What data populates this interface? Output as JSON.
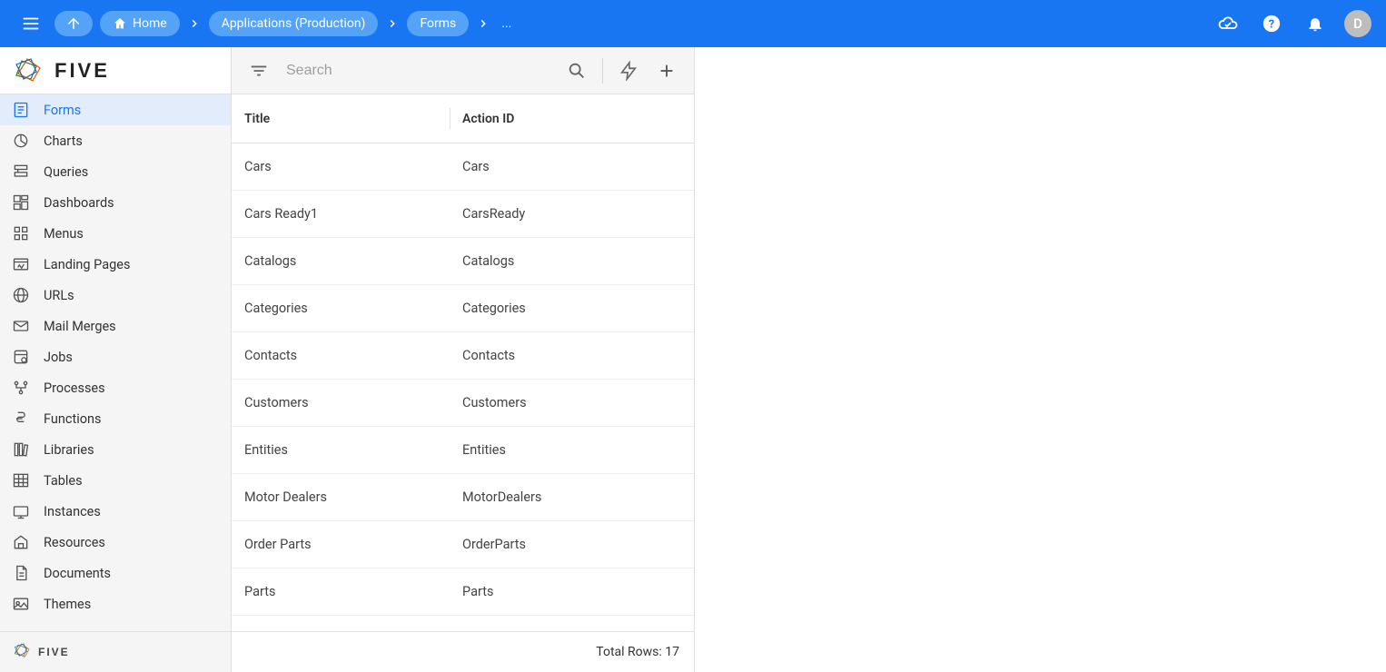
{
  "header": {
    "breadcrumbs": {
      "home": "Home",
      "applications": "Applications (Production)",
      "forms": "Forms",
      "ellipsis": "..."
    },
    "avatar_initial": "D"
  },
  "sidebar": {
    "items": [
      {
        "label": "Forms",
        "icon": "forms",
        "active": true
      },
      {
        "label": "Charts",
        "icon": "charts",
        "active": false
      },
      {
        "label": "Queries",
        "icon": "queries",
        "active": false
      },
      {
        "label": "Dashboards",
        "icon": "dashboards",
        "active": false
      },
      {
        "label": "Menus",
        "icon": "menus",
        "active": false
      },
      {
        "label": "Landing Pages",
        "icon": "landing",
        "active": false
      },
      {
        "label": "URLs",
        "icon": "urls",
        "active": false
      },
      {
        "label": "Mail Merges",
        "icon": "mail",
        "active": false
      },
      {
        "label": "Jobs",
        "icon": "jobs",
        "active": false
      },
      {
        "label": "Processes",
        "icon": "processes",
        "active": false
      },
      {
        "label": "Functions",
        "icon": "functions",
        "active": false
      },
      {
        "label": "Libraries",
        "icon": "libraries",
        "active": false
      },
      {
        "label": "Tables",
        "icon": "tables",
        "active": false
      },
      {
        "label": "Instances",
        "icon": "instances",
        "active": false
      },
      {
        "label": "Resources",
        "icon": "resources",
        "active": false
      },
      {
        "label": "Documents",
        "icon": "documents",
        "active": false
      },
      {
        "label": "Themes",
        "icon": "themes",
        "active": false
      }
    ]
  },
  "content": {
    "search_placeholder": "Search",
    "columns": {
      "title": "Title",
      "action_id": "Action ID"
    },
    "rows": [
      {
        "title": "Cars",
        "action_id": "Cars"
      },
      {
        "title": "Cars Ready1",
        "action_id": "CarsReady"
      },
      {
        "title": "Catalogs",
        "action_id": "Catalogs"
      },
      {
        "title": "Categories",
        "action_id": "Categories"
      },
      {
        "title": "Contacts",
        "action_id": "Contacts"
      },
      {
        "title": "Customers",
        "action_id": "Customers"
      },
      {
        "title": "Entities",
        "action_id": "Entities"
      },
      {
        "title": "Motor Dealers",
        "action_id": "MotorDealers"
      },
      {
        "title": "Order Parts",
        "action_id": "OrderParts"
      },
      {
        "title": "Parts",
        "action_id": "Parts"
      }
    ],
    "total_rows_label": "Total Rows: 17"
  }
}
